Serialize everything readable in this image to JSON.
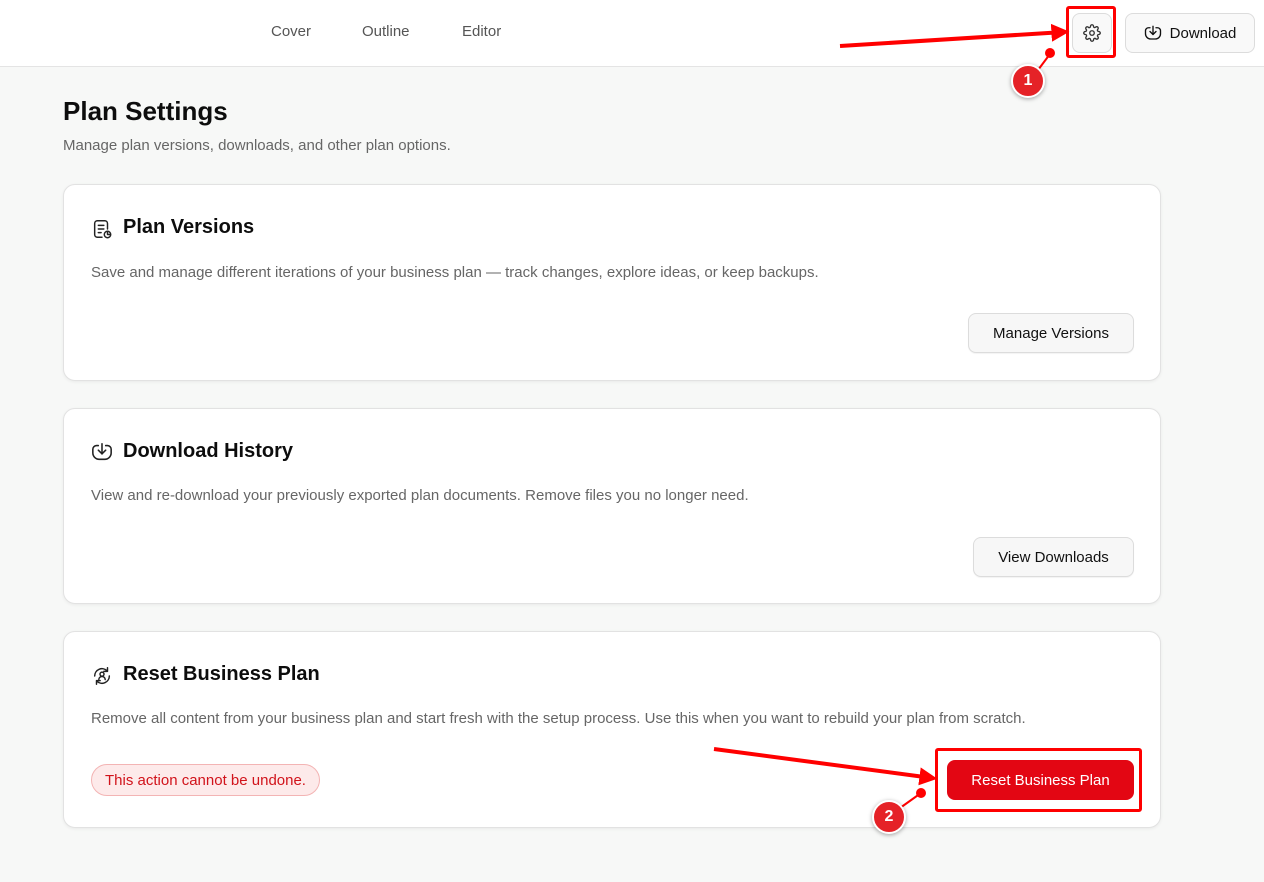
{
  "topbar": {
    "tabs": [
      {
        "label": "Cover"
      },
      {
        "label": "Outline"
      },
      {
        "label": "Editor"
      }
    ],
    "download_label": "Download"
  },
  "page": {
    "title": "Plan Settings",
    "subtitle": "Manage plan versions, downloads, and other plan options."
  },
  "cards": {
    "versions": {
      "title": "Plan Versions",
      "description": "Save and manage different iterations of your business plan — track changes, explore ideas, or keep backups.",
      "button_label": "Manage Versions"
    },
    "downloads": {
      "title": "Download History",
      "description": "View and re-download your previously exported plan documents. Remove files you no longer need.",
      "button_label": "View Downloads"
    },
    "reset": {
      "title": "Reset Business Plan",
      "description": "Remove all content from your business plan and start fresh with the setup process. Use this when you want to rebuild your plan from scratch.",
      "warning": "This action cannot be undone.",
      "button_label": "Reset Business Plan"
    }
  },
  "annotations": {
    "markers": [
      {
        "label": "1"
      },
      {
        "label": "2"
      }
    ]
  },
  "icons": {
    "settings": "gear-icon",
    "download": "download-icon",
    "versions": "document-versions-icon",
    "download_history": "download-icon",
    "reset": "reset-user-icon"
  },
  "colors": {
    "accent_red": "#e30613",
    "annotation_red": "#ff0000",
    "warning_bg": "#fdeaea",
    "warning_text": "#d1131b",
    "page_bg": "#f7f8f7"
  }
}
